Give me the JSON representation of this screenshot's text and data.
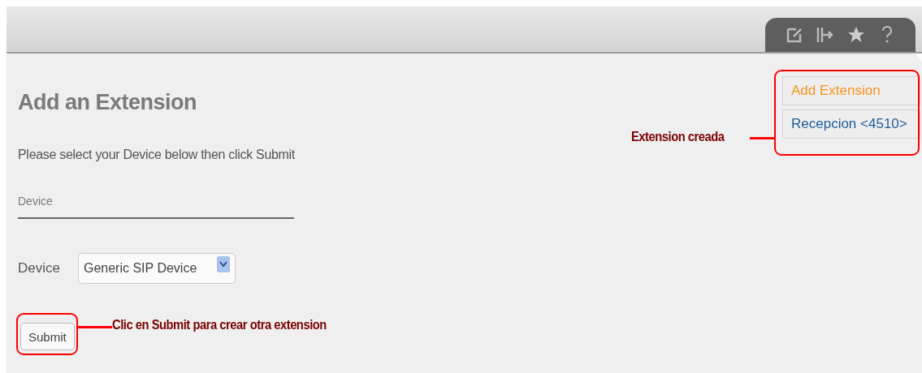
{
  "page": {
    "title": "Add an Extension",
    "instructions": "Please select your Device below then click Submit"
  },
  "device_section": {
    "heading": "Device",
    "field_label": "Device",
    "select_value": "Generic SIP Device"
  },
  "submit_button": "Submit",
  "sidebar": {
    "items": [
      {
        "label": "Add Extension",
        "selected": true
      },
      {
        "label": "Recepcion <4510>",
        "selected": false
      }
    ]
  },
  "annotations": [
    {
      "kind": "sidebar",
      "text": "Extension creada"
    },
    {
      "kind": "submit",
      "text": "Clic en Submit para crear otra extension"
    }
  ]
}
